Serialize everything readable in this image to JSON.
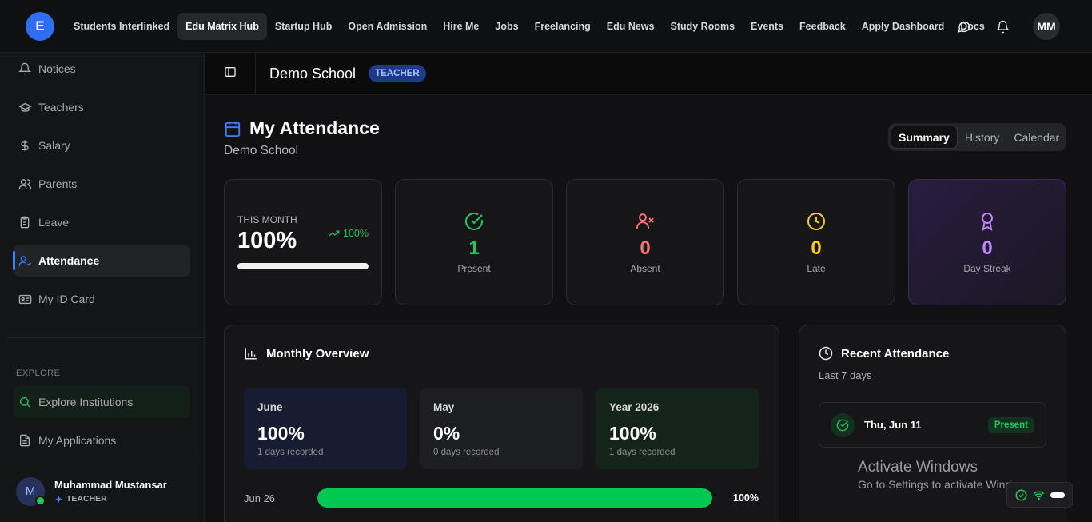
{
  "nav": {
    "logo_letter": "E",
    "links": [
      "Students Interlinked",
      "Edu Matrix Hub",
      "Startup Hub",
      "Open Admission",
      "Hire Me",
      "Jobs",
      "Freelancing",
      "Edu News",
      "Study Rooms",
      "Events",
      "Feedback",
      "Apply Dashboard",
      "Docs"
    ],
    "active_link": "Edu Matrix Hub",
    "avatar_initials": "MM"
  },
  "sidebar": {
    "items": [
      {
        "label": "Notices",
        "icon": "bell-icon"
      },
      {
        "label": "Teachers",
        "icon": "graduation-cap-icon"
      },
      {
        "label": "Salary",
        "icon": "dollar-icon"
      },
      {
        "label": "Parents",
        "icon": "users-icon"
      },
      {
        "label": "Leave",
        "icon": "clipboard-icon"
      },
      {
        "label": "Attendance",
        "icon": "user-check-icon",
        "active": true
      },
      {
        "label": "My ID Card",
        "icon": "id-card-icon"
      }
    ],
    "explore_label": "EXPLORE",
    "explore_items": [
      {
        "label": "Explore Institutions",
        "icon": "search-icon"
      },
      {
        "label": "My Applications",
        "icon": "document-icon"
      }
    ],
    "user": {
      "initial": "M",
      "name": "Muhammad Mustansar",
      "role": "TEACHER"
    }
  },
  "header": {
    "school": "Demo School",
    "role_badge": "TEACHER"
  },
  "page": {
    "title": "My Attendance",
    "subtitle": "Demo School",
    "tabs": [
      "Summary",
      "History",
      "Calendar"
    ],
    "active_tab": "Summary"
  },
  "stats": {
    "this_month": {
      "label": "THIS MONTH",
      "value": "100%",
      "trend": "100%",
      "progress": 1.0
    },
    "present": {
      "value": "1",
      "label": "Present"
    },
    "absent": {
      "value": "0",
      "label": "Absent"
    },
    "late": {
      "value": "0",
      "label": "Late"
    },
    "streak": {
      "value": "0",
      "label": "Day Streak"
    }
  },
  "colors": {
    "present": "#22c55e",
    "absent": "#f87171",
    "late": "#facc15",
    "streak": "#c084fc",
    "accent": "#3b82f6"
  },
  "overview": {
    "title": "Monthly Overview",
    "cards": [
      {
        "name": "June",
        "value": "100%",
        "sub": "1 days recorded"
      },
      {
        "name": "May",
        "value": "0%",
        "sub": "0 days recorded"
      },
      {
        "name": "Year 2026",
        "value": "100%",
        "sub": "1 days recorded"
      }
    ],
    "bar": {
      "label": "Jun 26",
      "percent_text": "100%",
      "fraction": 1.0
    }
  },
  "recent": {
    "title": "Recent Attendance",
    "subtitle": "Last 7 days",
    "items": [
      {
        "date": "Thu, Jun 11",
        "status": "Present"
      }
    ]
  },
  "watermark": {
    "title": "Activate Windows",
    "sub": "Go to Settings to activate Windows."
  }
}
